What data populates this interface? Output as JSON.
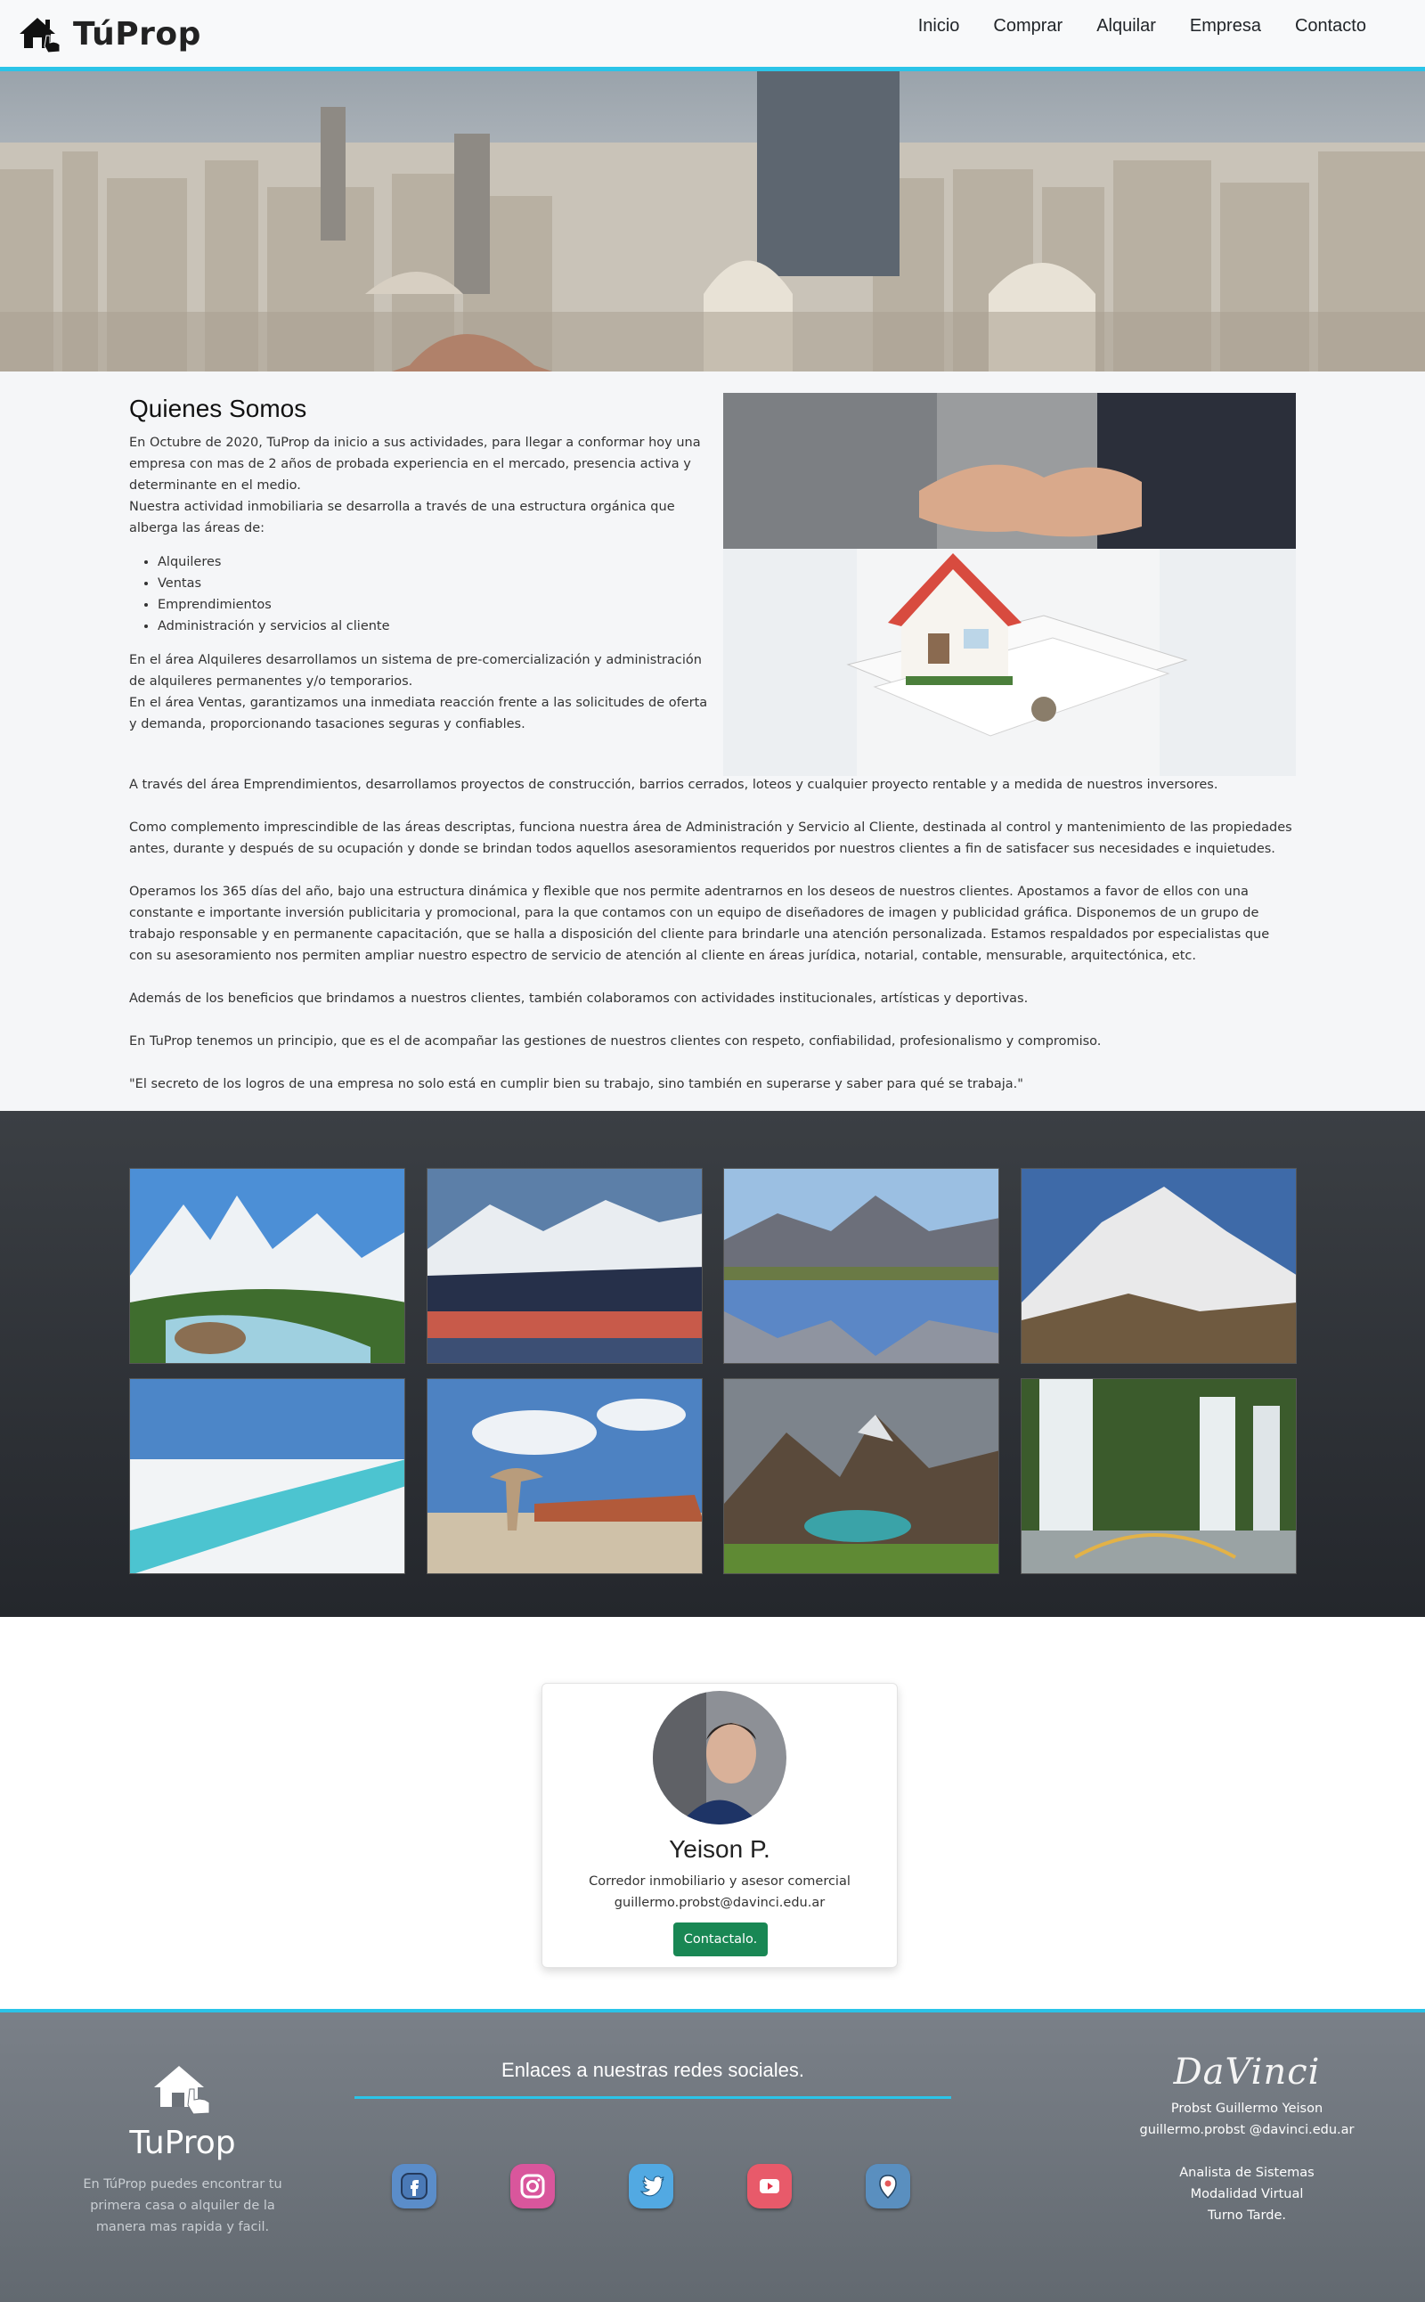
{
  "navbar": {
    "brand": "TúProp",
    "links": [
      "Inicio",
      "Comprar",
      "Alquilar",
      "Empresa",
      "Contacto"
    ]
  },
  "about": {
    "title": "Quienes Somos",
    "intro1": "En Octubre de 2020, TuProp da inicio a sus actividades, para llegar a conformar hoy una empresa con mas de 2 años de probada experiencia en el mercado, presencia activa y determinante en el medio.",
    "intro2": "Nuestra actividad inmobiliaria se desarrolla a través de una estructura orgánica que alberga las áreas de:",
    "areas": [
      "Alquileres",
      "Ventas",
      "Emprendimientos",
      "Administración y servicios al cliente"
    ],
    "p_alquileres": "En el área Alquileres desarrollamos un sistema de pre-comercialización y administración de alquileres permanentes y/o temporarios.",
    "p_ventas": "En el área Ventas, garantizamos una inmediata reacción frente a las solicitudes de oferta y demanda, proporcionando tasaciones seguras y confiables.",
    "p_emprend": "A través del área Emprendimientos, desarrollamos proyectos de construcción, barrios cerrados, loteos y cualquier proyecto rentable y a medida de nuestros inversores.",
    "p_admin": "Como complemento imprescindible de las áreas descriptas, funciona nuestra área de Administración y Servicio al Cliente, destinada al control y mantenimiento de las propiedades antes, durante y después de su ocupación y donde se brindan todos aquellos asesoramientos requeridos por nuestros clientes a fin de satisfacer sus necesidades e inquietudes.",
    "p_operamos": "Operamos los 365 días del año, bajo una estructura dinámica y flexible que nos permite adentrarnos en los deseos de nuestros clientes. Apostamos a favor de ellos con una constante e importante inversión publicitaria y promocional, para la que contamos con un equipo de diseñadores de imagen y publicidad gráfica. Disponemos de un grupo de trabajo responsable y en permanente capacitación, que se halla a disposición del cliente para brindarle una atención personalizada. Estamos respaldados por especialistas que con su asesoramiento nos permiten ampliar nuestro espectro de servicio de atención al cliente en áreas jurídica, notarial, contable, mensurable, arquitectónica, etc.",
    "p_beneficios": "Además de los beneficios que brindamos a nuestros clientes, también colaboramos con actividades institucionales, artísticas y deportivas.",
    "p_principio": "En TuProp tenemos un principio, que es el de acompañar las gestiones de nuestros clientes con respeto, confiabilidad, profesionalismo y compromiso.",
    "p_quote": "\"El secreto de los logros de una empresa no solo está en cumplir bien su trabajo, sino también en superarse y saber para qué se trabaja.\""
  },
  "card": {
    "name": "Yeison P.",
    "role": "Corredor inmobiliario y asesor comercial",
    "email": "guillermo.probst@davinci.edu.ar",
    "button": "Contactalo."
  },
  "footer": {
    "brand": "TuProp",
    "description": "En TúProp puedes encontrar tu primera casa o alquiler de la manera mas rapida y facil.",
    "social_title": "Enlaces a nuestras redes sociales.",
    "socials": [
      "facebook-icon",
      "instagram-icon",
      "twitter-icon",
      "youtube-icon",
      "location-icon"
    ],
    "logo": "DaVinci",
    "author": "Probst Guillermo Yeison",
    "author_email": "guillermo.probst @davinci.edu.ar",
    "career": "Analista de Sistemas",
    "modality": "Modalidad Virtual",
    "shift": "Turno Tarde."
  },
  "colors": {
    "accent": "#2bc4e8",
    "button": "#198754",
    "gallery_bg": "#2f3338",
    "footer_bg": "#6e757c"
  }
}
